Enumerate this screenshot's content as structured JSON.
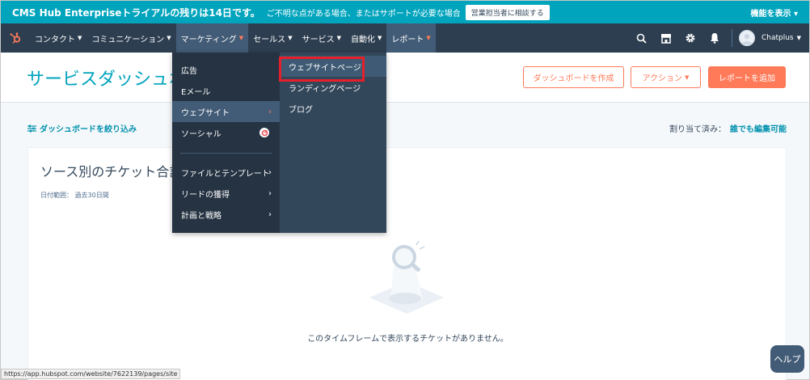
{
  "banner": {
    "title": "CMS Hub Enterpriseトライアルの残りは14日です。",
    "message": "ご不明な点がある場合、またはサポートが必要な場合",
    "button": "営業担当者に相談する",
    "right": "機能を表示"
  },
  "nav": {
    "items": [
      {
        "label": "コンタクト"
      },
      {
        "label": "コミュニケーション"
      },
      {
        "label": "マーケティング"
      },
      {
        "label": "セールス"
      },
      {
        "label": "サービス"
      },
      {
        "label": "自動化"
      },
      {
        "label": "レポート"
      }
    ],
    "account": "Chatplus"
  },
  "page": {
    "title": "サービスダッシュボード",
    "create_dashboard": "ダッシュボードを作成",
    "actions": "アクション",
    "add_report": "レポートを追加",
    "filter": "ダッシュボードを絞り込み",
    "assigned_label": "割り当て済み：",
    "assigned_value": "誰でも編集可能"
  },
  "card": {
    "title": "ソース別のチケット合計",
    "range": "日付範囲： 過去30日間",
    "empty": "このタイムフレームで表示するチケットがありません。"
  },
  "menu": {
    "left": [
      "広告",
      "Eメール",
      "ウェブサイト",
      "ソーシャル",
      "ファイルとテンプレート",
      "リードの獲得",
      "計画と戦略"
    ],
    "right": [
      "ウェブサイトページ",
      "ランディングページ",
      "ブログ"
    ]
  },
  "status_url": "https://app.hubspot.com/website/7622139/pages/site",
  "help": "ヘルプ",
  "colors": {
    "teal": "#00a4bd",
    "nav": "#2d3e50",
    "orange": "#ff7a59",
    "highlight": "#e5202a"
  }
}
